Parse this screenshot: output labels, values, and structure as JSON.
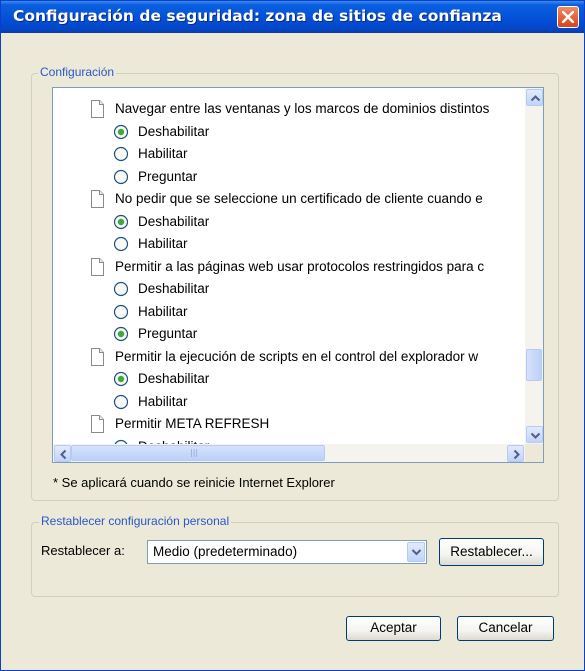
{
  "window": {
    "title": "Configuración de seguridad: zona de sitios de confianza",
    "close_icon": "close-x-icon"
  },
  "settings_group": {
    "label": "Configuración",
    "items": [
      {
        "kind": "setting",
        "label": "Navegar entre las ventanas y los marcos de dominios distintos",
        "icon": "document-icon"
      },
      {
        "kind": "option",
        "label": "Deshabilitar",
        "selected": true
      },
      {
        "kind": "option",
        "label": "Habilitar",
        "selected": false
      },
      {
        "kind": "option",
        "label": "Preguntar",
        "selected": false
      },
      {
        "kind": "setting",
        "label": "No pedir que se seleccione un certificado de cliente cuando e",
        "icon": "document-icon"
      },
      {
        "kind": "option",
        "label": "Deshabilitar",
        "selected": true
      },
      {
        "kind": "option",
        "label": "Habilitar",
        "selected": false
      },
      {
        "kind": "setting",
        "label": "Permitir a las páginas web usar protocolos restringidos para c",
        "icon": "document-icon"
      },
      {
        "kind": "option",
        "label": "Deshabilitar",
        "selected": false
      },
      {
        "kind": "option",
        "label": "Habilitar",
        "selected": false
      },
      {
        "kind": "option",
        "label": "Preguntar",
        "selected": true
      },
      {
        "kind": "setting",
        "label": "Permitir la ejecución de scripts en el control del explorador w",
        "icon": "document-icon"
      },
      {
        "kind": "option",
        "label": "Deshabilitar",
        "selected": true
      },
      {
        "kind": "option",
        "label": "Habilitar",
        "selected": false
      },
      {
        "kind": "setting",
        "label": "Permitir META REFRESH",
        "icon": "document-icon"
      },
      {
        "kind": "option",
        "label": "Deshabilitar",
        "selected": false
      }
    ],
    "note": "* Se aplicará cuando se reinicie Internet Explorer"
  },
  "reset_group": {
    "label": "Restablecer configuración personal",
    "reset_to_label": "Restablecer a:",
    "selected_level": "Medio (predeterminado)",
    "reset_button": "Restablecer..."
  },
  "buttons": {
    "ok": "Aceptar",
    "cancel": "Cancelar"
  },
  "colors": {
    "title_bar": "#0552d8",
    "close_button": "#d6441c",
    "group_label": "#2a56c8",
    "dialog_background": "#ece9d8"
  }
}
